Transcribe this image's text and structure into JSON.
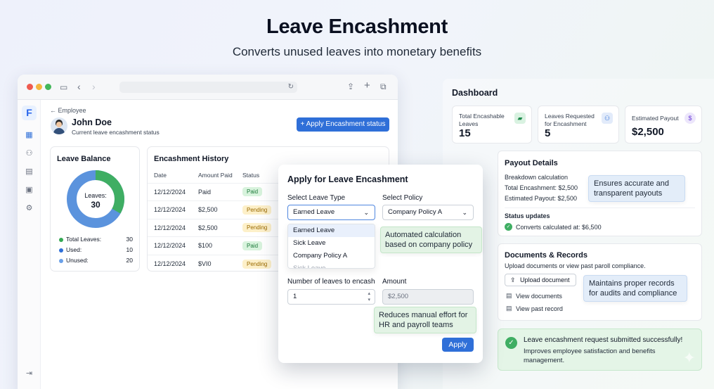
{
  "header": {
    "title": "Leave Encashment",
    "subtitle": "Converts unused leaves into monetary benefits"
  },
  "app": {
    "back_label": "← Employee",
    "employee_name": "John Doe",
    "employee_sub": "Current leave encashment status",
    "apply_button": "+ Apply Encashment status",
    "icons": [
      "dashboard-icon",
      "users-icon",
      "document-icon",
      "calendar-icon",
      "settings-icon",
      "logout-icon"
    ]
  },
  "leave_balance": {
    "title": "Leave Balance",
    "center_label": "Leaves:",
    "center_value": "30",
    "legend": [
      {
        "label": "Total Leaves:",
        "value": "30",
        "color": "#34a853"
      },
      {
        "label": "Used:",
        "value": "10",
        "color": "#2f6fd8"
      },
      {
        "label": "Unused:",
        "value": "20",
        "color": "#6aa0e8"
      }
    ],
    "donut": {
      "used": 10,
      "unused": 20,
      "used_color": "#3fae63",
      "unused_color": "#5b93dd"
    }
  },
  "history": {
    "title": "Encashment History",
    "columns": [
      "Date",
      "Amount Paid",
      "Status"
    ],
    "rows": [
      {
        "date": "12/12/2024",
        "amount": "Paid",
        "status": "Paid"
      },
      {
        "date": "12/12/2024",
        "amount": "$2,500",
        "status": "Pending"
      },
      {
        "date": "12/12/2024",
        "amount": "$2,500",
        "status": "Pending"
      },
      {
        "date": "12/12/2024",
        "amount": "$100",
        "status": "Paid"
      },
      {
        "date": "12/12/2024",
        "amount": "$VI0",
        "status": "Pending"
      }
    ]
  },
  "modal": {
    "title": "Apply for Leave Encashment",
    "leave_type_label": "Select Leave Type",
    "leave_type_value": "Earned Leave",
    "policy_label": "Select Policy",
    "policy_value": "Company Policy A",
    "dropdown_options": [
      "Earned Leave",
      "Sick Leave",
      "Company Policy A",
      "Sick Leave"
    ],
    "num_label": "Number of leaves to encash",
    "num_value": "1",
    "amount_label": "Amount",
    "amount_value": "$2,500",
    "apply_button": "Apply",
    "tip_auto": "Automated calculation based on company policy",
    "tip_manual": "Reduces manual effort for HR and payroll teams"
  },
  "dashboard": {
    "title": "Dashboard",
    "cards": [
      {
        "label": "Total Encashable Leaves",
        "value": "15",
        "icon": "wallet-icon",
        "color": "#22a05a"
      },
      {
        "label": "Leaves Requested for Encashment",
        "value": "5",
        "icon": "user-check-icon",
        "color": "#2f6fd8"
      },
      {
        "label": "Estimated Payout",
        "value": "$2,500",
        "icon": "dollar-icon",
        "color": "#7c3aed"
      }
    ],
    "payout": {
      "title": "Payout Details",
      "breakdown": "Breakdown calculation",
      "total": "Total Encashment: $2,500",
      "estimated": "Estimated Payout: $2,500",
      "status_title": "Status updates",
      "status_item": "Converts calculated at: $6,500",
      "tip": "Ensures accurate and transparent payouts"
    },
    "documents": {
      "title": "Documents & Records",
      "sub": "Upload documents or view past paroll compliance.",
      "upload": "Upload document",
      "view": "View documents",
      "past": "View past record",
      "tip": "Maintains proper records for audits and compliance"
    },
    "success": {
      "title": "Leave encashment request submitted successfully!",
      "body": "Improves employee satisfaction and benefits management."
    }
  }
}
